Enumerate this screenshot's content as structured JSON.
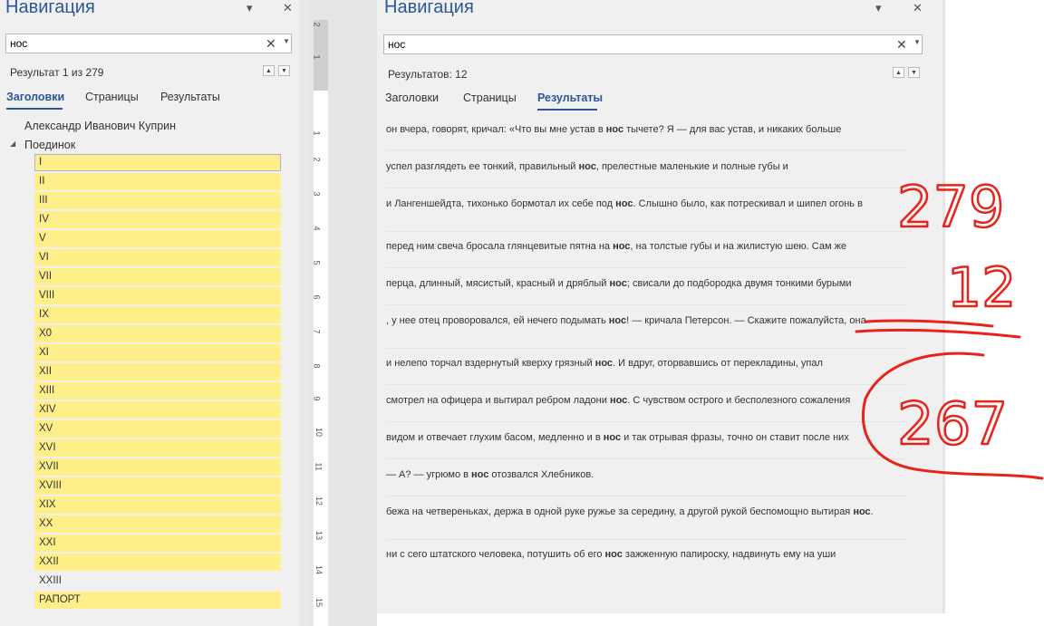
{
  "left": {
    "title": "Навигация",
    "pin_glyph": "▾",
    "close_glyph": "✕",
    "search_value": "нос",
    "result_text": "Результат 1 из 279",
    "tabs": [
      "Заголовки",
      "Страницы",
      "Результаты"
    ],
    "active_tab": "Заголовки",
    "author": "Александр Иванович Куприн",
    "book": "Поединок",
    "chapters": [
      "I",
      "II",
      "III",
      "IV",
      "V",
      "VI",
      "VII",
      "VIII",
      "IX",
      "X0",
      "XI",
      "XII",
      "XIII",
      "XIV",
      "XV",
      "XVI",
      "XVII",
      "XVIII",
      "XIX",
      "XX",
      "XXI",
      "XXII",
      "XXIII",
      "РАПОРТ"
    ]
  },
  "right": {
    "title": "Навигация",
    "pin_glyph": "▾",
    "close_glyph": "✕",
    "search_value": "нос",
    "result_text": "Результатов: 12",
    "tabs": [
      "Заголовки",
      "Страницы",
      "Результаты"
    ],
    "active_tab": "Результаты",
    "results": [
      {
        "pre": "он вчера, говорят, кричал: «Что вы мне устав в ",
        "hit": "нос",
        "post": " тычете? Я — для вас устав, и никаких больше"
      },
      {
        "pre": "успел разглядеть ее тонкий, правильный ",
        "hit": "нос",
        "post": ", прелестные маленькие и полные губы и"
      },
      {
        "pre": "и Лангеншейдта, тихонько бормотал их себе под ",
        "hit": "нос",
        "post": ". Слышно было, как потрескивал и шипел огонь в"
      },
      {
        "pre": "перед ним свеча бросала глянцевитые пятна на ",
        "hit": "нос",
        "post": ", на толстые губы и на жилистую шею. Сам же"
      },
      {
        "pre": "перца, длинный, мясистый, красный и дряблый ",
        "hit": "нос",
        "post": "; свисали до подбородка двумя тонкими бурыми"
      },
      {
        "pre": ", у нее отец проворовался, ей нечего подымать ",
        "hit": "нос",
        "post": "! — кричала Петерсон. — Скажите пожалуйста, она"
      },
      {
        "pre": "и нелепо торчал вздернутый кверху грязный ",
        "hit": "нос",
        "post": ". И вдруг, оторвавшись от перекладины, упал"
      },
      {
        "pre": "смотрел на офицера и вытирал ребром ладони ",
        "hit": "нос",
        "post": ". С чувством острого и бесполезного сожаления"
      },
      {
        "pre": "видом и отвечает глухим басом, медленно и в ",
        "hit": "нос",
        "post": " и так отрывая фразы, точно он ставит после них"
      },
      {
        "pre": "— А? — угрюмо в ",
        "hit": "нос",
        "post": " отозвался Хлебников."
      },
      {
        "pre": "бежа на четвереньках, держа в одной руке ружье за середину, а другой рукой беспомощно вытирая ",
        "hit": "нос",
        "post": "."
      },
      {
        "pre": "ни с сего штатского человека, потушить об его ",
        "hit": "нос",
        "post": " зажженную папироску, надвинуть ему на уши"
      }
    ]
  },
  "ruler": {
    "labels": [
      "2",
      "1",
      "1",
      "2",
      "3",
      "4",
      "5",
      "6",
      "7",
      "8",
      "9",
      "10",
      "11",
      "12",
      "13",
      "14",
      "15"
    ]
  },
  "annotations": {
    "color": "#e8231c",
    "numbers": [
      "279",
      "12",
      "267"
    ]
  }
}
